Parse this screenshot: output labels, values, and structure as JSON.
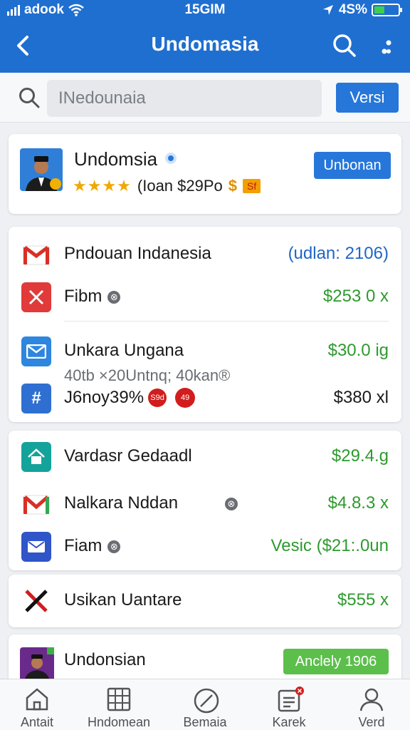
{
  "status": {
    "carrier": "adook",
    "time": "15GIM",
    "battery": "4S%",
    "battery_level": 0.45
  },
  "appbar": {
    "title": "Undomasia"
  },
  "search": {
    "placeholder": "INedounaia",
    "button": "Versi"
  },
  "profile": {
    "name": "Undomsia",
    "rating_text": "(Ioan $29Po",
    "stars": 3.5,
    "price_tag": "$",
    "tag_text": "Sf",
    "button": "Unbonan"
  },
  "list1": {
    "header_name": "Pndouan Indanesia",
    "header_value": "(udlan: 2106)",
    "rows": [
      {
        "name": "Fibm",
        "value": "$253 0 x"
      },
      {
        "name": "Unkara Ungana",
        "value": "$30.0 ig",
        "sub": "40tb ×20Untnq; 40kan®"
      },
      {
        "name": "J6noy39%",
        "badge1": "S9d",
        "badge2": "49",
        "value": "$380 xl"
      }
    ]
  },
  "list2": {
    "rows": [
      {
        "name": "Vardasr Gedaadl",
        "value": "$29.4.g"
      },
      {
        "name": "Nalkara Nddan",
        "value": "$4.8.3 x"
      },
      {
        "name": "Fiam",
        "value": "Vesic ($21:.0un"
      }
    ]
  },
  "list3": {
    "name": "Usikan Uantare",
    "value": "$555 x"
  },
  "list4": {
    "name": "Undonsian",
    "button": "Anclely 1906"
  },
  "nav": [
    "Antait",
    "Hndomean",
    "Bemaia",
    "Karek",
    "Verd"
  ]
}
